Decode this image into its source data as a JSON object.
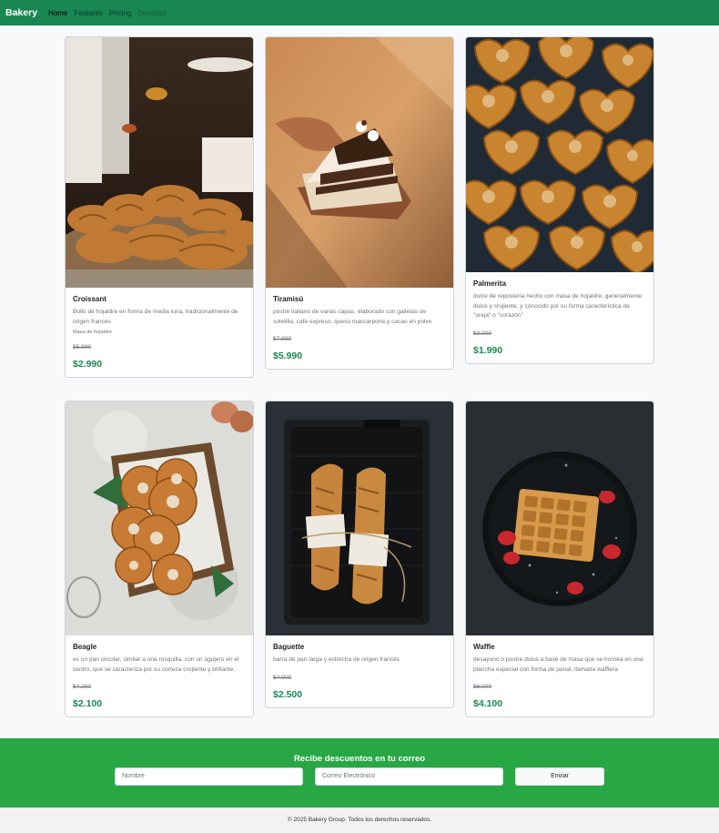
{
  "navbar": {
    "brand": "Bakery",
    "links": [
      {
        "label": "Home"
      },
      {
        "label": "Features"
      },
      {
        "label": "Pricing"
      },
      {
        "label": "Disabled"
      }
    ]
  },
  "products": [
    {
      "title": "Croissant",
      "description": "Bollo de hojaldre en forma de media luna, tradicionalmente de origen francés",
      "note": "Masa de hojaldre",
      "old_price": "$5.990",
      "price": "$2.990"
    },
    {
      "title": "Tiramisú",
      "description": "postre italiano de varias capas, elaborado con galletas de soletilla, café expreso, queso mascarpone,y cacao en polvo",
      "old_price": "$7.990",
      "price": "$5.990"
    },
    {
      "title": "Palmerita",
      "description": "dulce de repostería hecho con masa de hojaldre, generalmente dulce y crujiente, y conocido por su forma característica de \"oreja\" o \"corazón\"",
      "old_price": "$3.000",
      "price": "$1.990"
    },
    {
      "title": "Beagle",
      "description": "es un pan circular, similar a una rosquilla, con un agujero en el centro, que se caracteriza por su corteza crujiente y brillante.",
      "old_price": "$4.200",
      "price": "$2.100"
    },
    {
      "title": "Baguette",
      "description": "barra de pan larga y estrecha de origen francés",
      "old_price": "$4.000",
      "price": "$2.500"
    },
    {
      "title": "Waffle",
      "description": "desayuno o postre dulce a base de masa que se hornea en una plancha especial con forma de panal, llamada wafflera",
      "old_price": "$6.000",
      "price": "$4.100"
    }
  ],
  "subscribe": {
    "title": "Recibe descuentos en tu correo",
    "name_placeholder": "Nombre",
    "email_placeholder": "Correo Electrónico",
    "button": "Enviar"
  },
  "footer": {
    "text": "© 2025 Bakery Group. Todos los derechos reservados."
  },
  "colors": {
    "navbar": "#198754",
    "subscribe": "#28a745",
    "price": "#198754"
  }
}
